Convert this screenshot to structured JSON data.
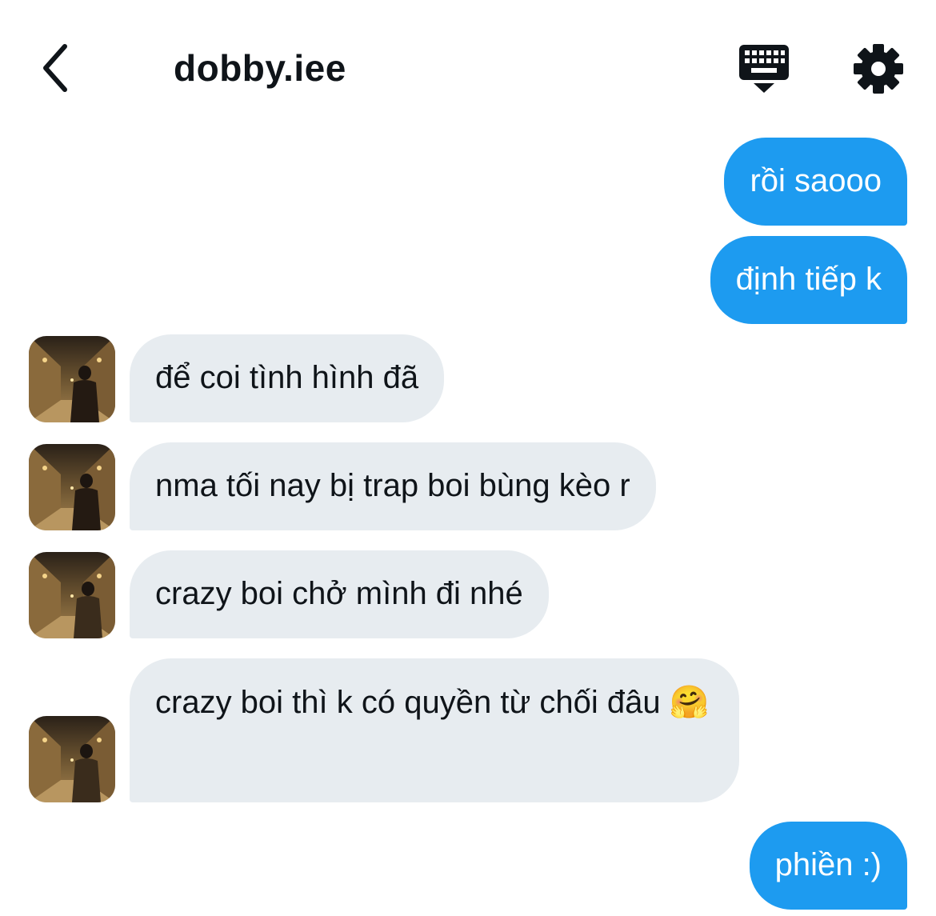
{
  "header": {
    "title": "dobby.iee",
    "back_icon": "chevron-left-icon",
    "keyboard_icon": "keyboard-icon",
    "settings_icon": "gear-icon"
  },
  "colors": {
    "outgoing_bubble": "#1d9bf0",
    "incoming_bubble": "#e7ecf0",
    "text": "#0f1419"
  },
  "messages": [
    {
      "direction": "outgoing",
      "text": "rồi saooo"
    },
    {
      "direction": "outgoing",
      "text": "định tiếp k"
    },
    {
      "direction": "incoming",
      "text": "để coi tình hình đã"
    },
    {
      "direction": "incoming",
      "text": "nma tối nay bị trap boi bùng kèo r"
    },
    {
      "direction": "incoming",
      "text": "crazy boi chở mình đi nhé"
    },
    {
      "direction": "incoming",
      "text": "crazy boi thì k có quyền từ chối đâu 🤗"
    },
    {
      "direction": "outgoing",
      "text": "phiền :)"
    }
  ]
}
